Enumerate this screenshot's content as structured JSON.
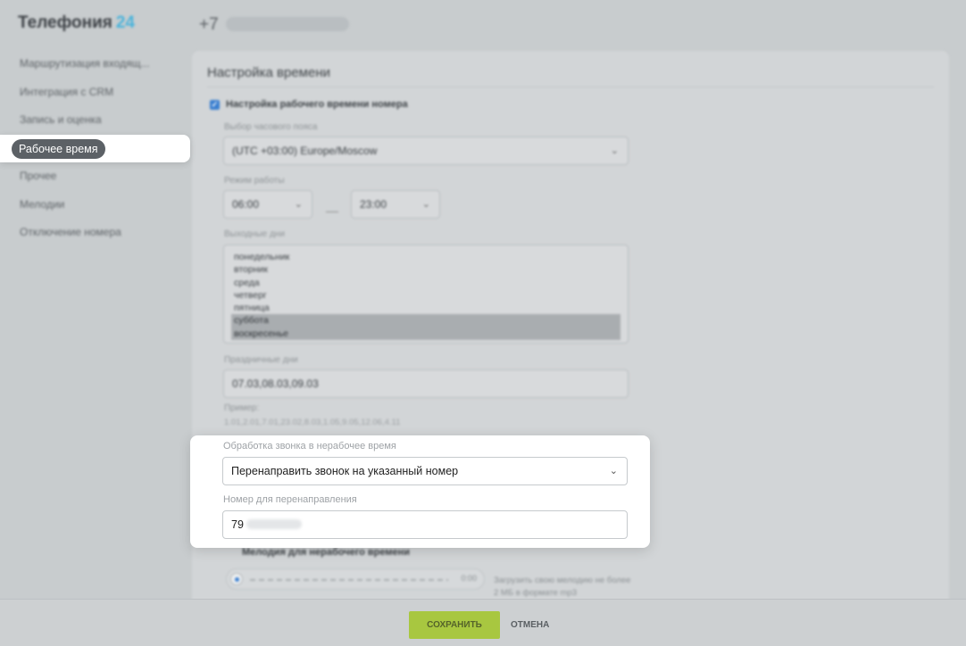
{
  "app": {
    "brand_name": "Телефония",
    "brand_number": "24",
    "phone_prefix": "+7"
  },
  "sidebar": {
    "items": [
      {
        "label": "Маршрутизация входящ..."
      },
      {
        "label": "Интеграция с CRM"
      },
      {
        "label": "Запись и оценка"
      },
      {
        "label": "Рабочее время"
      },
      {
        "label": "Прочее"
      },
      {
        "label": "Мелодии"
      },
      {
        "label": "Отключение номера"
      }
    ],
    "active_index": 3
  },
  "settings": {
    "title": "Настройка времени",
    "checkbox_label": "Настройка рабочего времени номера",
    "timezone_label": "Выбор часового пояса",
    "timezone_value": "(UTC +03:00) Europe/Moscow",
    "mode_label": "Режим работы",
    "time_from": "06:00",
    "time_to": "23:00",
    "weekend_label": "Выходные дни",
    "weekdays": [
      "понедельник",
      "вторник",
      "среда",
      "четверг",
      "пятница",
      "суббота",
      "воскресенье"
    ],
    "holidays_label": "Праздничные дни",
    "holidays_value": "07.03,08.03,09.03",
    "example_label": "Пример:",
    "example_value": "1.01,2.01,7.01,23.02,8.03,1.05,9.05,12.06,4.11",
    "offhours_label": "Обработка звонка в нерабочее время",
    "offhours_value": "Перенаправить звонок на указанный номер",
    "redirect_label": "Номер для перенаправления",
    "redirect_value": "79",
    "melody_title": "Мелодия для нерабочего времени",
    "melody_duration": "0:00",
    "upload_text": "Загрузить свою мелодию не более 2 МБ в формате mp3"
  },
  "footer": {
    "save_label": "СОХРАНИТЬ",
    "cancel_label": "ОТМЕНА"
  }
}
